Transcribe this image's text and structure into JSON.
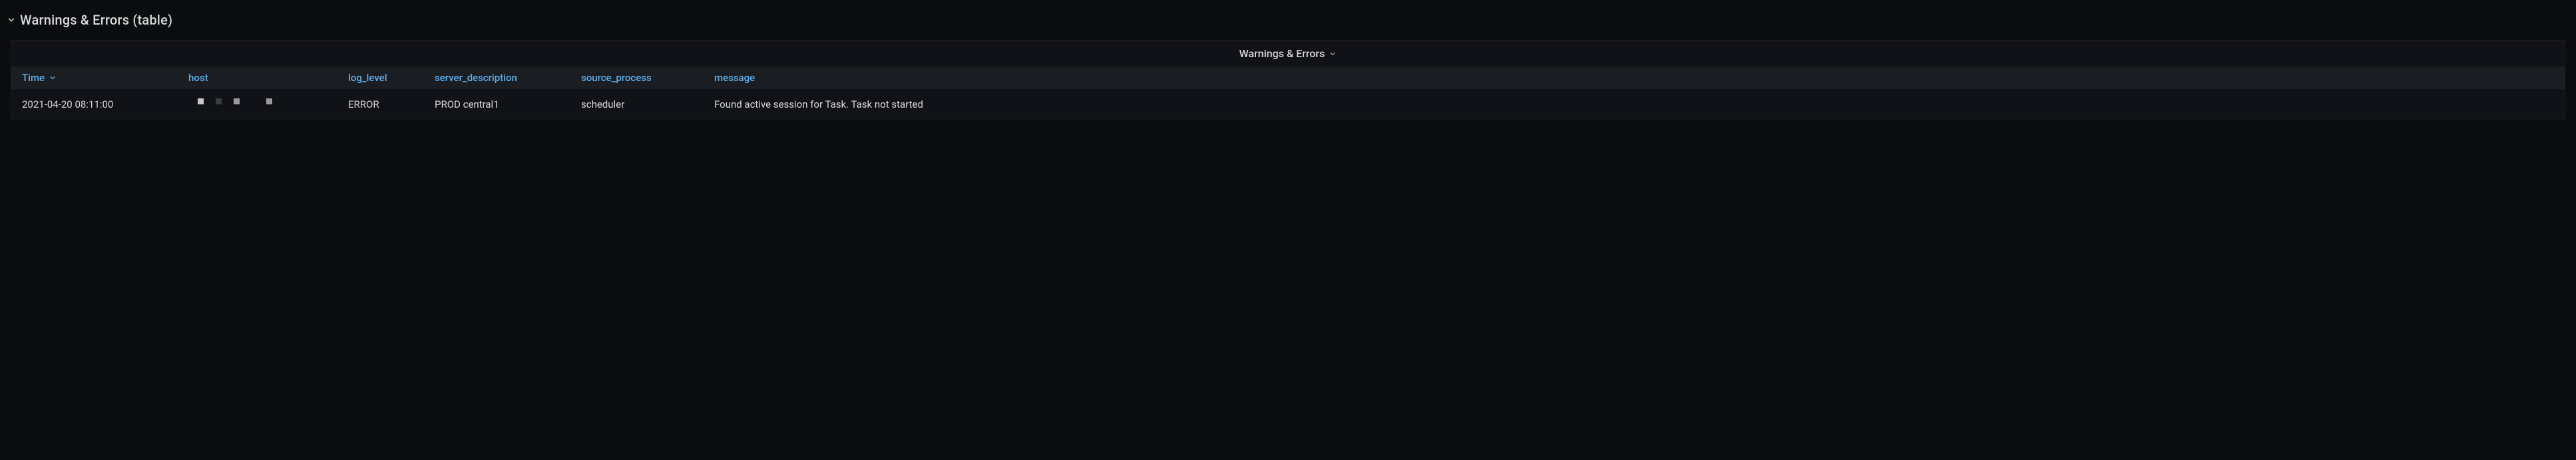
{
  "panel": {
    "title": "Warnings & Errors (table)",
    "inner_title": "Warnings & Errors"
  },
  "table": {
    "headers": {
      "time": "Time",
      "host": "host",
      "log_level": "log_level",
      "server_description": "server_description",
      "source_process": "source_process",
      "message": "message"
    },
    "rows": [
      {
        "time": "2021-04-20 08:11:00",
        "host": "",
        "log_level": "ERROR",
        "server_description": "PROD central1",
        "source_process": "scheduler",
        "message": "Found active session for Task. Task not started"
      }
    ]
  },
  "colors": {
    "accent": "#5eb0ef",
    "text": "#d8d9da",
    "bg": "#0a0c0e",
    "panel_bg": "#111217",
    "header_bg": "#1a1d21"
  }
}
